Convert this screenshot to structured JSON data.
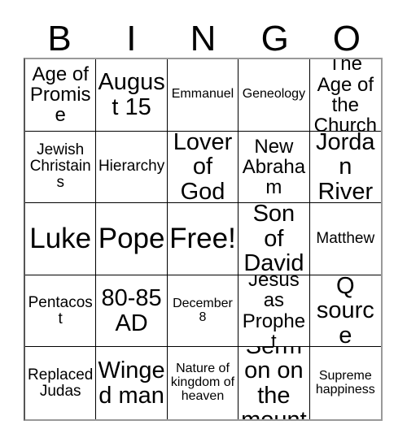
{
  "card": {
    "title": "BINGO",
    "header_letters": [
      "B",
      "I",
      "N",
      "G",
      "O"
    ],
    "columns": 5,
    "rows": 5,
    "free_space_label": "Free!",
    "colors": {
      "background": "#ffffff",
      "text": "#000000",
      "grid_line": "#000000",
      "outer_border": "#999999"
    },
    "cells": [
      {
        "text": "Age of Promise",
        "size": "lg"
      },
      {
        "text": "August 15",
        "size": "xl"
      },
      {
        "text": "Emmanuel",
        "size": "sm"
      },
      {
        "text": "Geneology",
        "size": "sm"
      },
      {
        "text": "The Age of the Church",
        "size": "lg"
      },
      {
        "text": "Jewish Christains",
        "size": "md"
      },
      {
        "text": "Hierarchy",
        "size": "md"
      },
      {
        "text": "Lover of God",
        "size": "xl"
      },
      {
        "text": "New Abraham",
        "size": "lg"
      },
      {
        "text": "Jordan River",
        "size": "xl"
      },
      {
        "text": "Luke",
        "size": "xxl"
      },
      {
        "text": "Pope",
        "size": "xxl"
      },
      {
        "text": "Free!",
        "size": "xxl"
      },
      {
        "text": "Son of David",
        "size": "xl"
      },
      {
        "text": "Matthew",
        "size": "md"
      },
      {
        "text": "Pentacost",
        "size": "md"
      },
      {
        "text": "80-85 AD",
        "size": "xl"
      },
      {
        "text": "December 8",
        "size": "sm"
      },
      {
        "text": "Jesus as Prophet",
        "size": "lg"
      },
      {
        "text": "Q source",
        "size": "xl"
      },
      {
        "text": "Replaced Judas",
        "size": "md"
      },
      {
        "text": "Winged man",
        "size": "xl"
      },
      {
        "text": "Nature of kingdom of heaven",
        "size": "sm"
      },
      {
        "text": "Sermon on the mount",
        "size": "xl"
      },
      {
        "text": "Supreme happiness",
        "size": "sm"
      }
    ]
  }
}
